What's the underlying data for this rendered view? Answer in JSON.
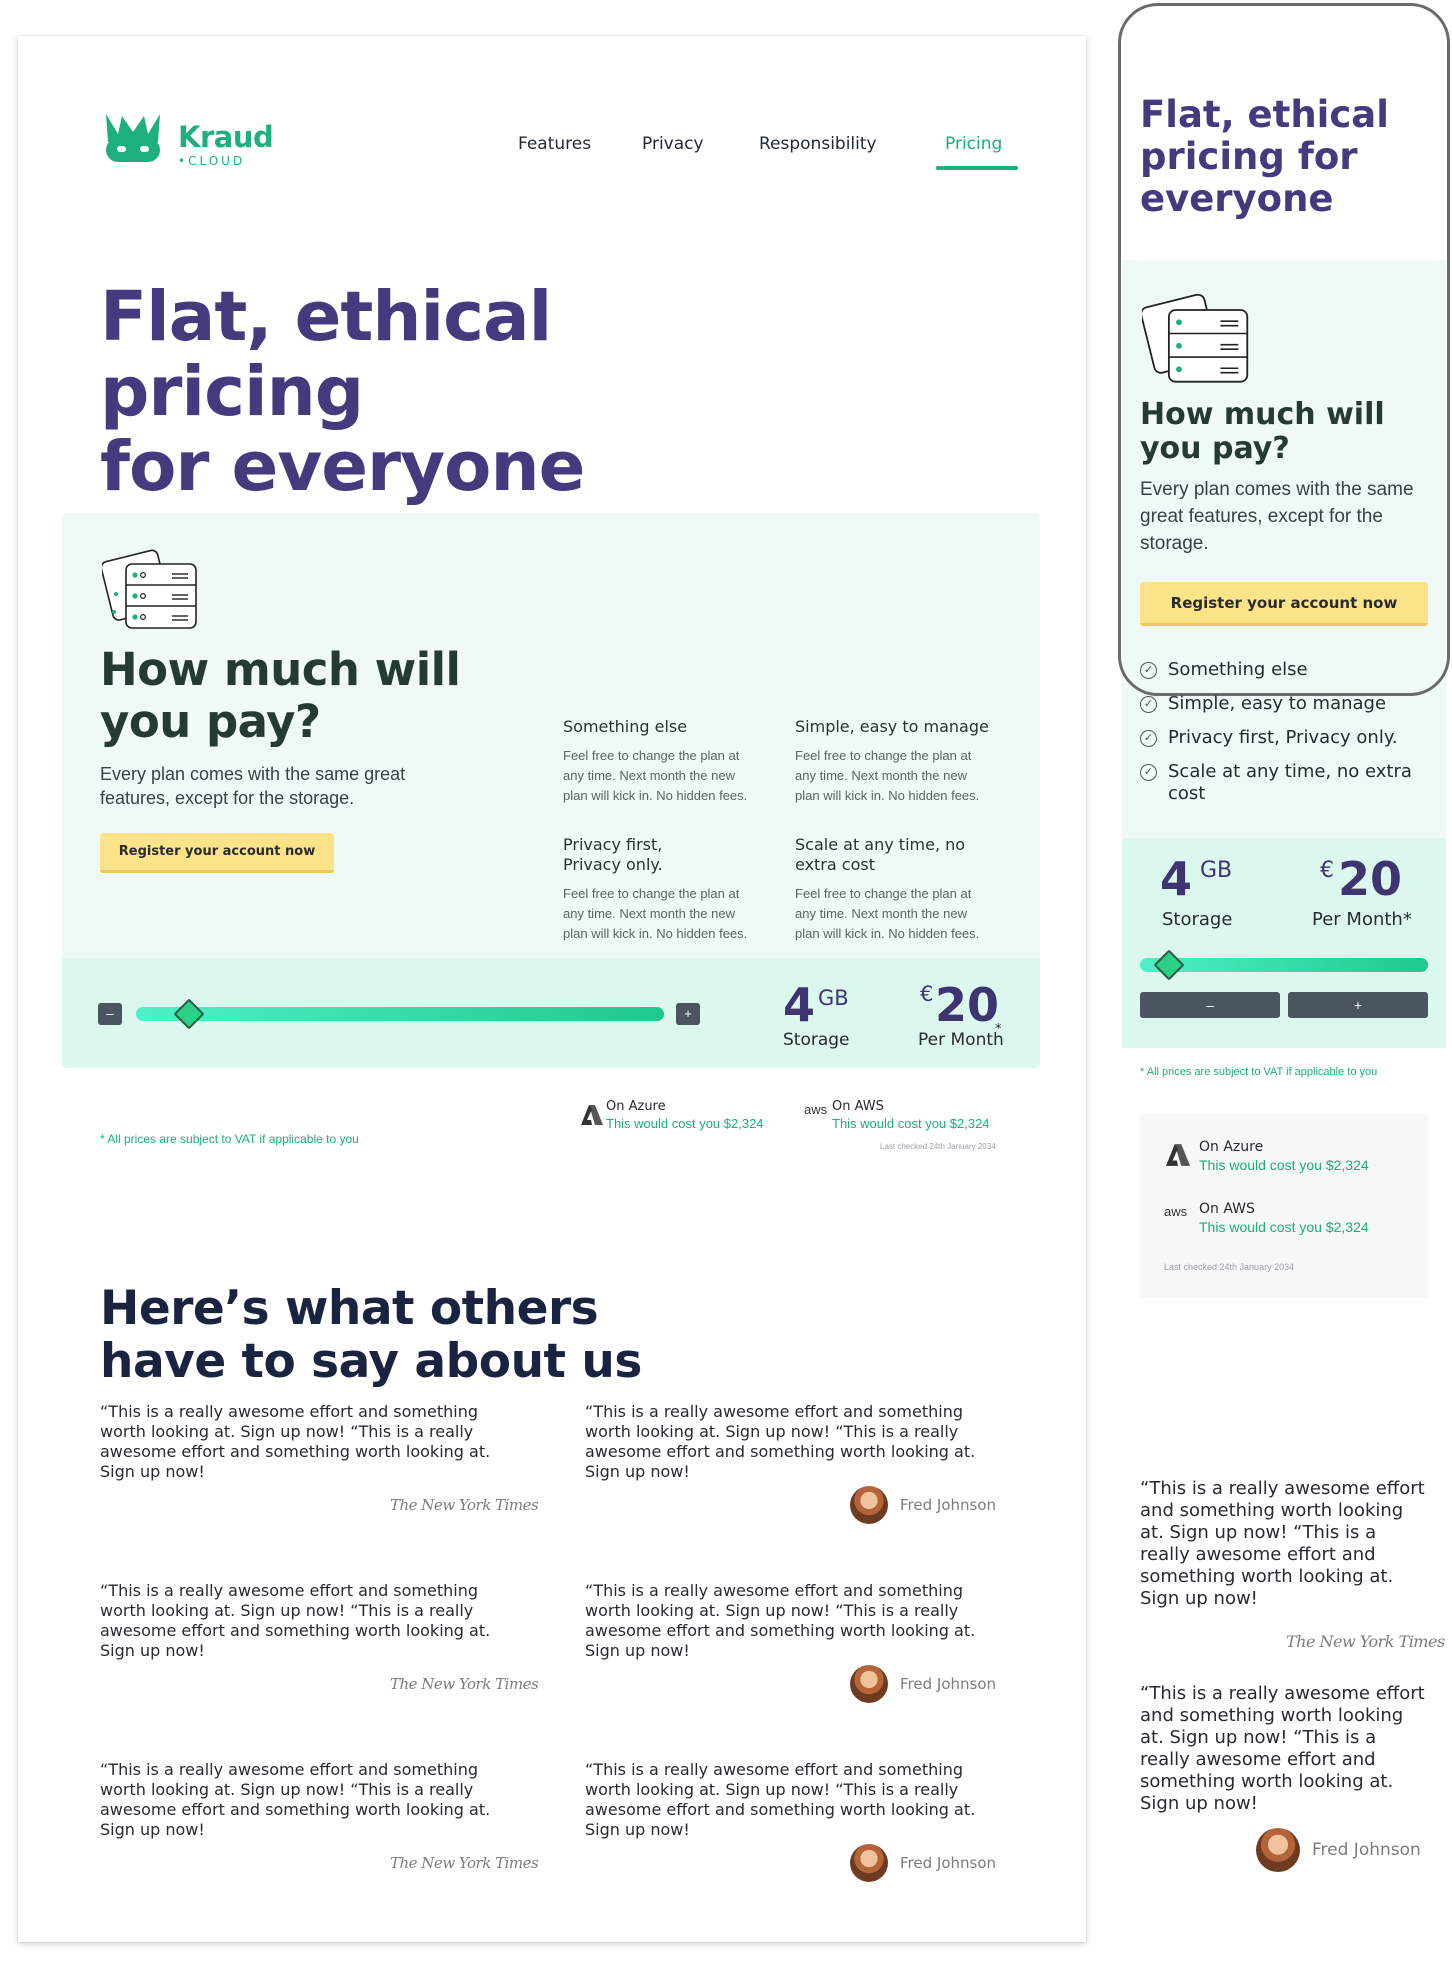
{
  "brand": {
    "name": "Kraud",
    "sub": "•CLOUD"
  },
  "nav": {
    "features": "Features",
    "privacy": "Privacy",
    "responsibility": "Responsibility",
    "pricing": "Pricing"
  },
  "hero": {
    "line1": "Flat, ethical pricing",
    "line2": "for everyone",
    "mobile_line1": "Flat, ethical",
    "mobile_line2": "pricing for",
    "mobile_line3": "everyone"
  },
  "pricing": {
    "title_line1": "How much will",
    "title_line2": "you pay?",
    "subtitle": "Every plan comes with the same great features, except for the storage.",
    "cta": "Register your account now",
    "features": [
      {
        "title": "Something else",
        "body": "Feel free to change the plan at any time. Next month the new plan will kick in. No hidden fees."
      },
      {
        "title": "Simple, easy to manage",
        "body": "Feel free to change the plan at any time. Next month the new plan will kick in. No hidden fees."
      },
      {
        "title": "Privacy first, Privacy only.",
        "body": "Feel free to change the plan at any time. Next month the new plan will kick in. No hidden fees."
      },
      {
        "title": "Scale at any time, no extra cost",
        "body": "Feel free to change the plan at any time. Next month the new plan will kick in. No hidden fees."
      }
    ],
    "mobile_features": [
      "Something else",
      "Simple, easy to manage",
      "Privacy first, Privacy only.",
      "Scale at any time, no extra cost"
    ],
    "storage_value": "4",
    "storage_unit": "GB",
    "storage_label": "Storage",
    "price_currency": "€",
    "price_value": "20",
    "price_label": "Per Month",
    "price_label_mobile": "Per Month*",
    "asterisk": "*",
    "minus": "–",
    "plus": "+",
    "slider_fraction": 0.1,
    "vat_note": "* All prices are subject to VAT if applicable to you",
    "compare": [
      {
        "provider": "On Azure",
        "cost": "This would cost you $2,324",
        "icon": "azure-icon",
        "logo": "A"
      },
      {
        "provider": "On AWS",
        "cost": "This would cost you $2,324",
        "icon": "aws-icon",
        "logo": "aws"
      }
    ],
    "last_checked": "Last checked 24th January 2034"
  },
  "testimonials": {
    "title_line1": "Here’s what others",
    "title_line2": "have to say about us",
    "quote": "“This is a really awesome effort and something worth looking at. Sign up now! “This is a really awesome effort and something worth looking at. Sign up now!",
    "source_nyt": "The New York Times",
    "author": "Fred Johnson"
  },
  "colors": {
    "brand_green": "#19b07a",
    "headline_purple": "#453a7e",
    "panel_mint": "#eff9f5",
    "cta_yellow": "#fbe38a"
  }
}
